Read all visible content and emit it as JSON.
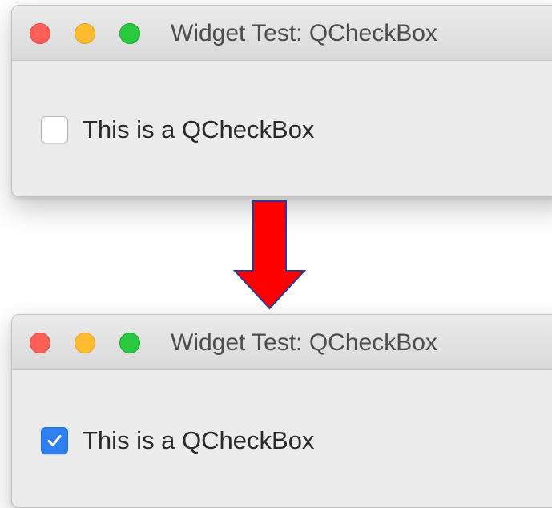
{
  "windows": [
    {
      "title": "Widget Test: QCheckBox",
      "checkbox": {
        "label": "This is a QCheckBox",
        "checked": false
      }
    },
    {
      "title": "Widget Test: QCheckBox",
      "checkbox": {
        "label": "This is a QCheckBox",
        "checked": true
      }
    }
  ],
  "arrow": {
    "color": "#ff0000",
    "outline": "#2b3a8f",
    "direction": "down",
    "icon": "down-arrow-icon"
  },
  "colors": {
    "close": "#fe5f57",
    "minimize": "#febc2e",
    "zoom": "#28c840",
    "checkbox_checked": "#2f7ff0",
    "window_bg": "#ececec"
  }
}
